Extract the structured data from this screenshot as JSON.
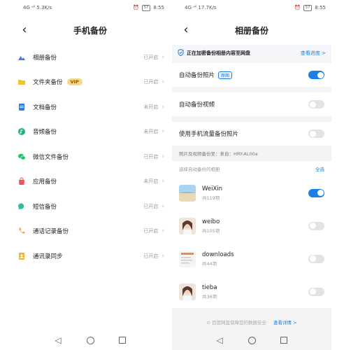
{
  "left": {
    "status": {
      "left_text": "4G ᵃˡˡ 5.3K/s",
      "right_text": "8:55",
      "battery": "57"
    },
    "title": "手机备份",
    "back_icon": "chevron-left-icon",
    "items": [
      {
        "label": "相册备份",
        "status": "已开启",
        "icon": "mountain-icon",
        "color": "#3f7fe6"
      },
      {
        "label": "文件夹备份",
        "status": "已开启",
        "icon": "folder-icon",
        "color": "#f3c233",
        "badge": "VIP"
      },
      {
        "label": "文档备份",
        "status": "未开启",
        "icon": "document-icon",
        "color": "#3c7ce8"
      },
      {
        "label": "音频备份",
        "status": "未开启",
        "icon": "music-note-icon",
        "color": "#22b577"
      },
      {
        "label": "微信文件备份",
        "status": "已开启",
        "icon": "wechat-icon",
        "color": "#23c36a"
      },
      {
        "label": "应用备份",
        "status": "未开启",
        "icon": "app-bag-icon",
        "color": "#ee5459"
      },
      {
        "label": "短信备份",
        "status": "已开启",
        "icon": "chat-bubble-icon",
        "color": "#2bc09b"
      },
      {
        "label": "通话记录备份",
        "status": "已开启",
        "icon": "phone-icon",
        "color": "#f0a52c"
      },
      {
        "label": "通讯录同步",
        "status": "已开启",
        "icon": "contacts-icon",
        "color": "#f2b632"
      }
    ],
    "chevron": "›"
  },
  "right": {
    "status": {
      "left_text": "4G ᵃˡˡ 17.7K/s",
      "right_text": "8:55",
      "battery": "57"
    },
    "title": "相册备份",
    "banner": {
      "message": "正在加密备份相册内容至网盘",
      "link": "查看进度 >",
      "icon": "shield-check-icon"
    },
    "auto_photo": {
      "label": "自动备份照片",
      "tag": "原图",
      "on": true
    },
    "auto_video": {
      "label": "自动备份视频",
      "on": false
    },
    "mobile_data": {
      "label": "使用手机流量备份照片",
      "on": false
    },
    "source_line": "照片及视频备份至：来自：HRY-AL00a",
    "albums_header": {
      "label": "选择自动备份的相册",
      "select_all": "全选"
    },
    "albums": [
      {
        "name": "WeiXin",
        "count": "共119项",
        "on": true,
        "thumb": "beach-photo"
      },
      {
        "name": "weibo",
        "count": "共105项",
        "on": false,
        "thumb": "portrait-photo"
      },
      {
        "name": "downloads",
        "count": "共44项",
        "on": false,
        "thumb": "document-thumb"
      },
      {
        "name": "tieba",
        "count": "共36项",
        "on": false,
        "thumb": "portrait-photo"
      }
    ],
    "footer": {
      "text": "⊙ 百度网盘保障您的数据安全",
      "link": "查看详情 >"
    }
  },
  "nav": {
    "back": "◁",
    "home": "○",
    "recent": "□"
  }
}
